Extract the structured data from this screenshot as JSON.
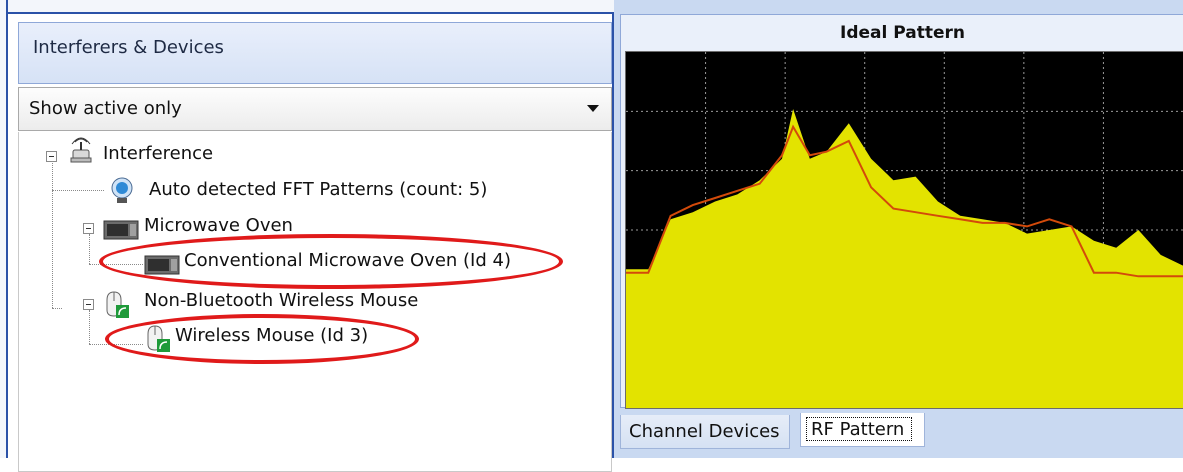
{
  "left_panel": {
    "header": "Interferers & Devices",
    "filter": {
      "selected": "Show active only"
    },
    "tree": [
      {
        "label": "Interference",
        "icon": "antenna-icon",
        "expanded": true
      },
      {
        "label": "Auto detected FFT Patterns (count: 5)",
        "icon": "fft-pattern-icon"
      },
      {
        "label": "Microwave Oven",
        "icon": "microwave-icon",
        "expanded": true
      },
      {
        "label": "Conventional Microwave Oven (Id 4)",
        "icon": "microwave-icon",
        "highlighted": true
      },
      {
        "label": "Non-Bluetooth Wireless Mouse",
        "icon": "wireless-mouse-icon",
        "expanded": true
      },
      {
        "label": "Wireless Mouse (Id 3)",
        "icon": "wireless-mouse-icon",
        "highlighted": true
      }
    ]
  },
  "chart": {
    "title": "Ideal Pattern",
    "colors": {
      "background": "#000000",
      "fill": "#e3e300",
      "line": "#d34a0a",
      "grid": "#9a9a9a"
    }
  },
  "tabs": [
    {
      "label": "Channel Devices",
      "active": false
    },
    {
      "label": "RF Pattern",
      "active": true
    }
  ],
  "chart_data": {
    "type": "area",
    "title": "Ideal Pattern",
    "xlabel": "",
    "ylabel": "",
    "grid": true,
    "x": [
      0,
      4,
      8,
      12,
      16,
      20,
      24,
      28,
      30,
      33,
      36,
      40,
      44,
      48,
      52,
      56,
      60,
      64,
      68,
      72,
      76,
      80,
      84,
      88,
      92,
      96,
      100
    ],
    "ylim": [
      0,
      100
    ],
    "series": [
      {
        "values": [
          39,
          39,
          53,
          55,
          58,
          60,
          64,
          70,
          84,
          70,
          72,
          80,
          70,
          64,
          65,
          58,
          54,
          53,
          52,
          49,
          50,
          51,
          47,
          45,
          50,
          43,
          40
        ]
      },
      {
        "values": [
          38,
          38,
          54,
          57,
          59,
          61,
          63,
          71,
          79,
          71,
          72,
          75,
          62,
          56,
          55,
          54,
          53,
          52,
          52,
          51,
          53,
          51,
          38,
          38,
          37,
          37,
          37
        ]
      }
    ]
  }
}
